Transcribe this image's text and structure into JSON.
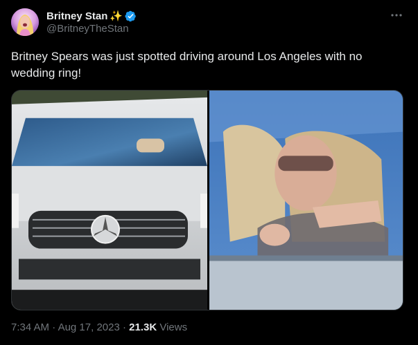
{
  "author": {
    "display_name": "Britney Stan",
    "name_emoji": "✨",
    "handle": "@BritneyTheStan",
    "verified": true,
    "avatar_icon": "avatar-photo"
  },
  "tweet": {
    "text": "Britney Spears was just spotted driving around Los Angeles with no wedding ring!"
  },
  "media": {
    "photos": [
      {
        "name": "photo-white-mercedes-front"
      },
      {
        "name": "photo-driver-closeup"
      }
    ]
  },
  "meta": {
    "time": "7:34 AM",
    "separator1": " · ",
    "date": "Aug 17, 2023",
    "separator2": " · ",
    "views_count": "21.3K",
    "views_label": " Views"
  },
  "colors": {
    "background": "#000000",
    "primary_text": "#e7e9ea",
    "secondary_text": "#71767b",
    "verified_blue": "#1d9bf0"
  },
  "icons": {
    "verified": "verified-badge-icon",
    "more": "more-options-icon"
  }
}
